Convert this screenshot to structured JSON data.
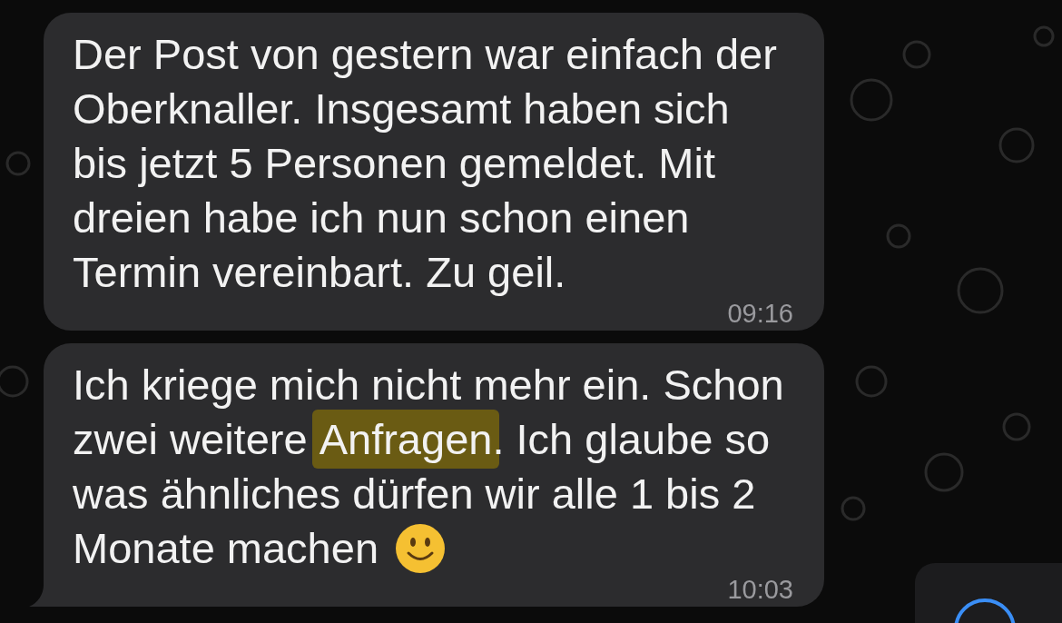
{
  "messages": [
    {
      "segments": [
        {
          "text": "Der Post von gestern war einfach der Oberknaller. Insgesamt haben sich bis jetzt 5 Personen gemeldet. Mit dreien habe ich nun schon einen Termin vereinbart. Zu geil.",
          "highlighted": false
        }
      ],
      "time": "09:16",
      "tail": false,
      "trailing_emoji": false
    },
    {
      "segments": [
        {
          "text": "Ich kriege mich nicht mehr ein. Schon zwei weitere ",
          "highlighted": false
        },
        {
          "text": "Anfragen",
          "highlighted": true
        },
        {
          "text": ". Ich glaube so was ähnliches dürfen wir alle 1 bis 2 Monate machen",
          "highlighted": false
        }
      ],
      "time": "10:03",
      "tail": true,
      "trailing_emoji": true
    }
  ],
  "scroll_down_button": {
    "visible": true
  }
}
